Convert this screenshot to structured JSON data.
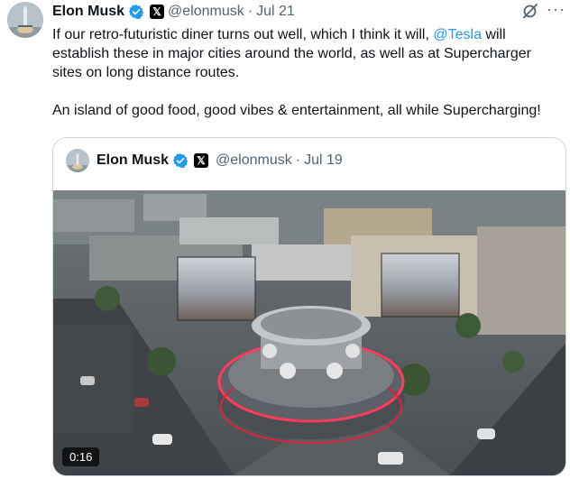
{
  "tweet": {
    "author_name": "Elon Musk",
    "handle": "@elonmusk",
    "separator": "·",
    "date": "Jul 21",
    "avatar_icon": "rocket-launch-avatar",
    "verified_color": "#1d9bf0",
    "text_before_mention": "If our retro-futuristic diner turns out well, which I think it will, ",
    "mention": "@Tesla",
    "text_after_mention": " will establish these in major cities around the world, as well as at Supercharger sites on long distance routes.",
    "paragraph_2": "An island of good food, good vibes & entertainment, all while Supercharging!"
  },
  "quoted": {
    "author_name": "Elon Musk",
    "handle": "@elonmusk",
    "separator": "·",
    "date": "Jul 19",
    "video_duration": "0:16"
  },
  "icons": {
    "x_badge": "𝕏",
    "more": "···"
  }
}
